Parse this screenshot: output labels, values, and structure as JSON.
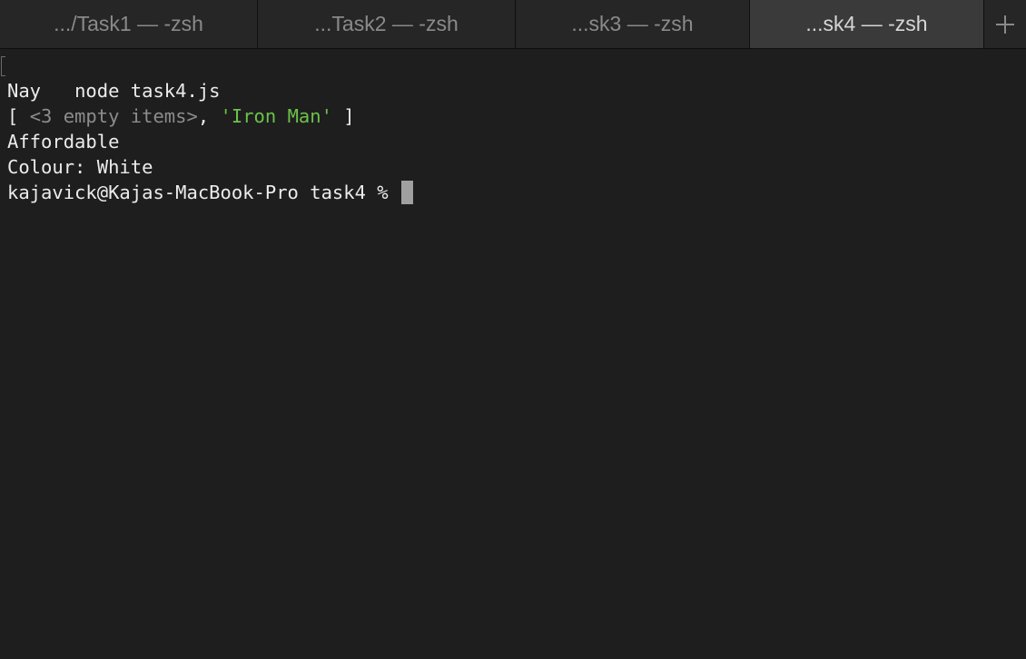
{
  "tabs": [
    {
      "label": ".../Task1 — -zsh",
      "active": false
    },
    {
      "label": "...Task2 — -zsh",
      "active": false
    },
    {
      "label": "...sk3 — -zsh",
      "active": false
    },
    {
      "label": "...sk4 — -zsh",
      "active": true
    }
  ],
  "new_tab_icon": "plus-icon",
  "terminal": {
    "command": "node task4.js",
    "output": {
      "line1": "Nay",
      "array_open": "[ ",
      "array_empty": "<3 empty items>",
      "array_sep": ", ",
      "array_string": "'Iron Man'",
      "array_close": " ]",
      "line3": "Affordable",
      "line4": "Colour: White"
    },
    "prompt": "kajavick@Kajas-MacBook-Pro task4 % "
  },
  "colors": {
    "background": "#1e1e1e",
    "text": "#ececec",
    "string_literal": "#6cc24a",
    "dim": "#8c8c8c"
  }
}
